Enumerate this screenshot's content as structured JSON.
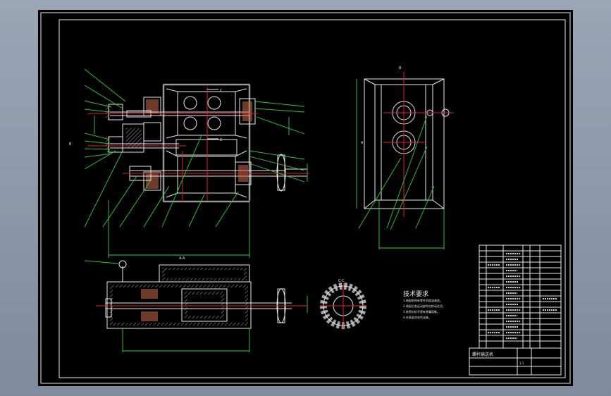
{
  "drawing": {
    "section_aa_label": "A-A",
    "section_cc_label": "C-C",
    "section_mark_c": "C",
    "section_mark_b": "B",
    "section_mark_a": "A",
    "notes_title": "技术要求",
    "notes": [
      "1.装配前所有零件用煤油清洗。",
      "2.装配后各运动部件应转动灵活。",
      "3.各密封处不得有渗漏现象。",
      "4.外表面涂灰色油漆。"
    ]
  },
  "title_block": {
    "drawing_name": "螺杆输送机",
    "scale_label": "1:1"
  },
  "colors": {
    "background": "#000000",
    "outline": "#e8e8e8",
    "leader": "#2fd02f",
    "centerline": "#e02020"
  }
}
